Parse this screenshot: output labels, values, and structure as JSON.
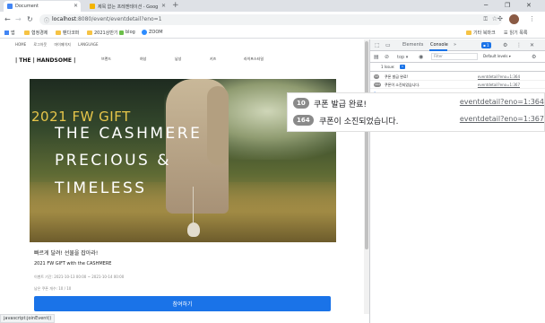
{
  "browser": {
    "tabs": [
      {
        "title": "Document",
        "active": true
      },
      {
        "title": "제목 없는 프레젠테이션 - Goog",
        "active": false
      }
    ],
    "url_host": "localhost",
    "url_path": ":8080/event/eventdetail?eno=1",
    "bookmarks": [
      "앱",
      "협정경제",
      "팬다코퍼",
      "2021상반기",
      "blog",
      "ZOOM"
    ],
    "bookmarks_right": [
      "기타 북마크",
      "읽기 목록"
    ],
    "status_text": "javascript:joinEvent()"
  },
  "site": {
    "topmenu": [
      "HOME",
      "로그아웃",
      "마이페이지",
      "LANGUAGE"
    ],
    "logo": "| THE | HANDSOME |",
    "gnb": [
      "브랜드",
      "여성",
      "남성",
      "키즈",
      "라이프스타일"
    ],
    "banner": {
      "line1": "2021 FW GIFT",
      "line2": "THE CASHMERE",
      "line3": "PRECIOUS &",
      "line4": "TIMELESS"
    },
    "desc_title": "빠르게 달려! 선물을 잡아라!",
    "desc_sub": "2021 FW GIFT with the CASHMERE",
    "desc_period": "이벤트 기간: 2021-10-13 00:00 ~ 2021-10-14 00:00",
    "desc_remaining": "남은 쿠폰 개수: 10 / 10",
    "join_button": "참여하기"
  },
  "devtools": {
    "tabs": [
      "Elements",
      "Console",
      "»"
    ],
    "badge": "1",
    "context": "top",
    "filter_placeholder": "Filter",
    "levels": "Default levels ▾",
    "issue_text": "1 Issue:",
    "issue_count": "1",
    "logs": [
      {
        "count": "10",
        "message": "쿠폰 발급 완료!",
        "source": "eventdetail?eno=1:364"
      },
      {
        "count": "164",
        "message": "쿠폰이 소진되었습니다.",
        "source": "eventdetail?eno=1:367"
      }
    ],
    "prompt": ">"
  },
  "colors": {
    "primary": "#1a73e8",
    "gift_gold": "#e7c64a"
  }
}
